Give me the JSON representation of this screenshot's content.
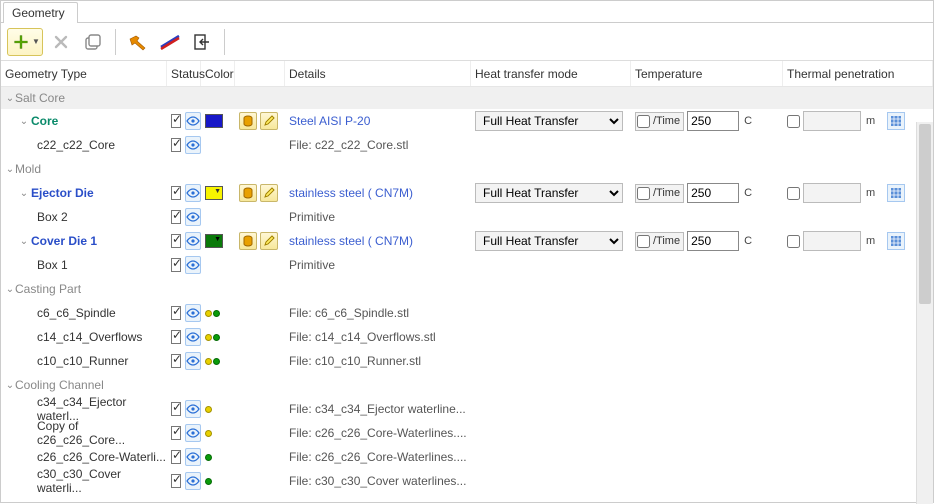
{
  "tab": {
    "title": "Geometry"
  },
  "cols": {
    "type": "Geometry Type",
    "status": "Status",
    "color": "Color",
    "details": "Details",
    "heat": "Heat transfer mode",
    "temp": "Temperature",
    "pen": "Thermal penetration"
  },
  "heatOption": "Full Heat Transfer",
  "timeLabel": "/Time",
  "tempVal": "250",
  "tempUnit": "C",
  "penUnit": "m",
  "groups": {
    "saltcore": "Salt Core",
    "mold": "Mold",
    "casting": "Casting Part",
    "cooling": "Cooling Channel"
  },
  "rows": {
    "core": {
      "name": "Core",
      "detail": "Steel AISI P-20",
      "colorSwatch": "#1818c8"
    },
    "c22": {
      "name": "c22_c22_Core",
      "detail": "File: c22_c22_Core.stl"
    },
    "ejector": {
      "name": "Ejector Die",
      "detail": "stainless steel ( CN7M)",
      "colorSwatch": "#f8f400"
    },
    "box2": {
      "name": "Box 2",
      "detail": "Primitive"
    },
    "coverdie": {
      "name": "Cover Die 1",
      "detail": "stainless steel ( CN7M)",
      "colorSwatch": "#0a7a0a"
    },
    "box1": {
      "name": "Box 1",
      "detail": "Primitive"
    },
    "spindle": {
      "name": "c6_c6_Spindle",
      "detail": "File: c6_c6_Spindle.stl"
    },
    "overflows": {
      "name": "c14_c14_Overflows",
      "detail": "File: c14_c14_Overflows.stl"
    },
    "runner": {
      "name": "c10_c10_Runner",
      "detail": "File: c10_c10_Runner.stl"
    },
    "c34": {
      "name": "c34_c34_Ejector waterl...",
      "detail": "File: c34_c34_Ejector waterline..."
    },
    "copyc26": {
      "name": "Copy of c26_c26_Core...",
      "detail": "File: c26_c26_Core-Waterlines...."
    },
    "c26": {
      "name": "c26_c26_Core-Waterli...",
      "detail": "File: c26_c26_Core-Waterlines...."
    },
    "c30": {
      "name": "c30_c30_Cover waterli...",
      "detail": "File: c30_c30_Cover waterlines..."
    }
  }
}
